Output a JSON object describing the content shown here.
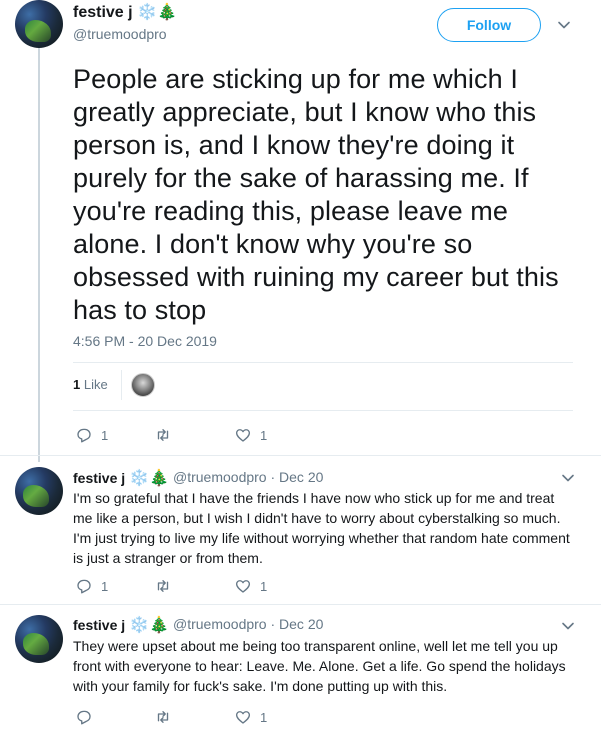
{
  "main_tweet": {
    "display_name": "festive j",
    "emoji_snow": "❄️",
    "emoji_tree": "🎄",
    "handle": "@truemoodpro",
    "follow_label": "Follow",
    "text": "People are sticking up for me which I greatly appreciate, but I know who this person is, and I know they're doing it purely for the sake of harassing me. If you're reading this, please leave me alone. I don't know why you're so obsessed with ruining my career but this has to stop",
    "timestamp": "4:56 PM - 20 Dec 2019",
    "likes_number": "1",
    "likes_word": "Like",
    "actions": {
      "reply_count": "1",
      "retweet_count": "",
      "like_count": "1"
    }
  },
  "replies": [
    {
      "display_name": "festive j",
      "emoji_snow": "❄️",
      "emoji_tree": "🎄",
      "handle": "@truemoodpro",
      "date": "· Dec 20",
      "text": "I'm so grateful that I have the friends I have now who stick up for me and treat me like a person, but I wish I didn't have to worry about cyberstalking so much. I'm just trying to live my life without worrying whether that random hate comment is just a stranger or from them.",
      "reply_count": "1",
      "retweet_count": "",
      "like_count": "1"
    },
    {
      "display_name": "festive j",
      "emoji_snow": "❄️",
      "emoji_tree": "🎄",
      "handle": "@truemoodpro",
      "date": "· Dec 20",
      "text": "They were upset about me being too transparent online, well let me tell you up front with everyone to hear: Leave. Me. Alone. Get a life. Go spend the holidays with your family for fuck's sake. I'm done putting up with this.",
      "reply_count": "",
      "retweet_count": "",
      "like_count": "1"
    }
  ],
  "colors": {
    "accent": "#1da1f2",
    "text_primary": "#14171a",
    "text_secondary": "#657786",
    "divider": "#e6ecf0"
  },
  "icons": [
    "reply-icon",
    "retweet-icon",
    "heart-icon",
    "chevron-down-icon"
  ]
}
